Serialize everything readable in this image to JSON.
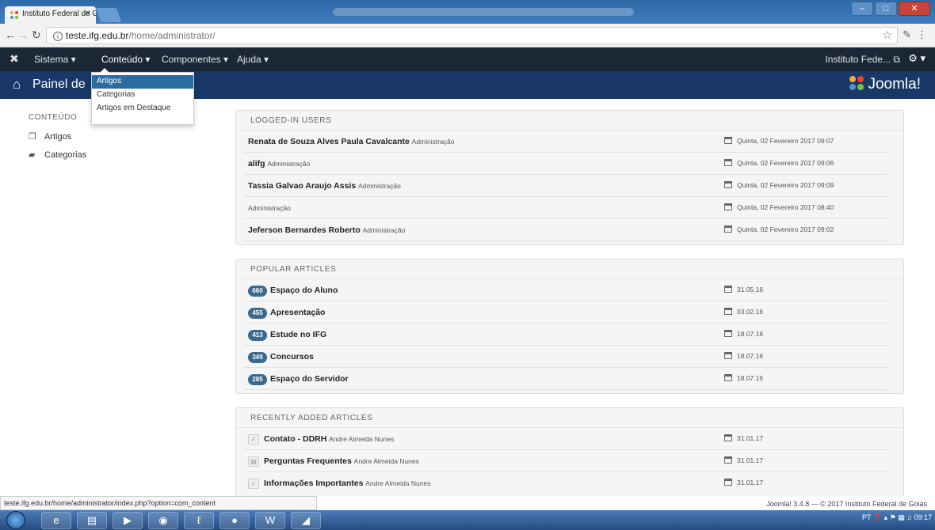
{
  "browser": {
    "tab_title": "Instituto Federal de Goiá",
    "url_host": "teste.ifg.edu.br",
    "url_path": "/home/administrator/",
    "status_url": "teste.ifg.edu.br/home/administrator/index.php?option=com_content"
  },
  "topnav": {
    "items": [
      "Sistema ▾",
      "Conteúdo ▾",
      "Componentes ▾",
      "Ajuda ▾"
    ],
    "site_name": "Instituto Fede... ⧉",
    "gear_caret": "▾"
  },
  "header": {
    "title": "Painel de",
    "brand": "Joomla!"
  },
  "dropdown": {
    "items": [
      "Artigos",
      "Categorias",
      "Artigos em Destaque"
    ]
  },
  "sidebar": {
    "heading": "CONTEÚDO",
    "items": [
      "Artigos",
      "Categorias"
    ]
  },
  "logged_in": {
    "title": "LOGGED-IN USERS",
    "rows": [
      {
        "name": "Renata de Souza Alves Paula Cavalcante",
        "role": "Administração",
        "date": "Quinta, 02 Fevereiro 2017 09:07"
      },
      {
        "name": "alifg",
        "role": "Administração",
        "date": "Quinta, 02 Fevereiro 2017 09:06"
      },
      {
        "name": "Tassia Galvao Araujo Assis",
        "role": "Administração",
        "date": "Quinta, 02 Fevereiro 2017 09:09"
      },
      {
        "name": "",
        "role": "Administração",
        "date": "Quinta, 02 Fevereiro 2017 08:40"
      },
      {
        "name": "Jeferson Bernardes Roberto",
        "role": "Administração",
        "date": "Quinta, 02 Fevereiro 2017 09:02"
      }
    ]
  },
  "popular": {
    "title": "POPULAR ARTICLES",
    "rows": [
      {
        "hits": "660",
        "title": "Espaço do Aluno",
        "date": "31.05.16"
      },
      {
        "hits": "455",
        "title": "Apresentação",
        "date": "03.02.16"
      },
      {
        "hits": "413",
        "title": "Estude no IFG",
        "date": "18.07.16"
      },
      {
        "hits": "349",
        "title": "Concursos",
        "date": "18.07.16"
      },
      {
        "hits": "285",
        "title": "Espaço do Servidor",
        "date": "18.07.16"
      }
    ]
  },
  "recent": {
    "title": "RECENTLY ADDED ARTICLES",
    "rows": [
      {
        "state": "✓",
        "title": "Contato - DDRH",
        "author": "Andre Almeida Nunes",
        "date": "31.01.17"
      },
      {
        "state": "▤",
        "title": "Perguntas Frequentes",
        "author": "Andre Almeida Nunes",
        "date": "31.01.17"
      },
      {
        "state": "✓",
        "title": "Informações Importantes",
        "author": "Andre Almeida Nunes",
        "date": "31.01.17"
      }
    ]
  },
  "footer": {
    "text": "Joomla! 3.4.8 — © 2017 Instituto Federal de Goiás"
  },
  "taskbar": {
    "lang": "PT",
    "time": "09:17"
  },
  "colors": {
    "topnav": "#1b2735",
    "header": "#1a3867",
    "badge": "#3a6a92",
    "dropdown_highlight": "#2d6ca2"
  }
}
